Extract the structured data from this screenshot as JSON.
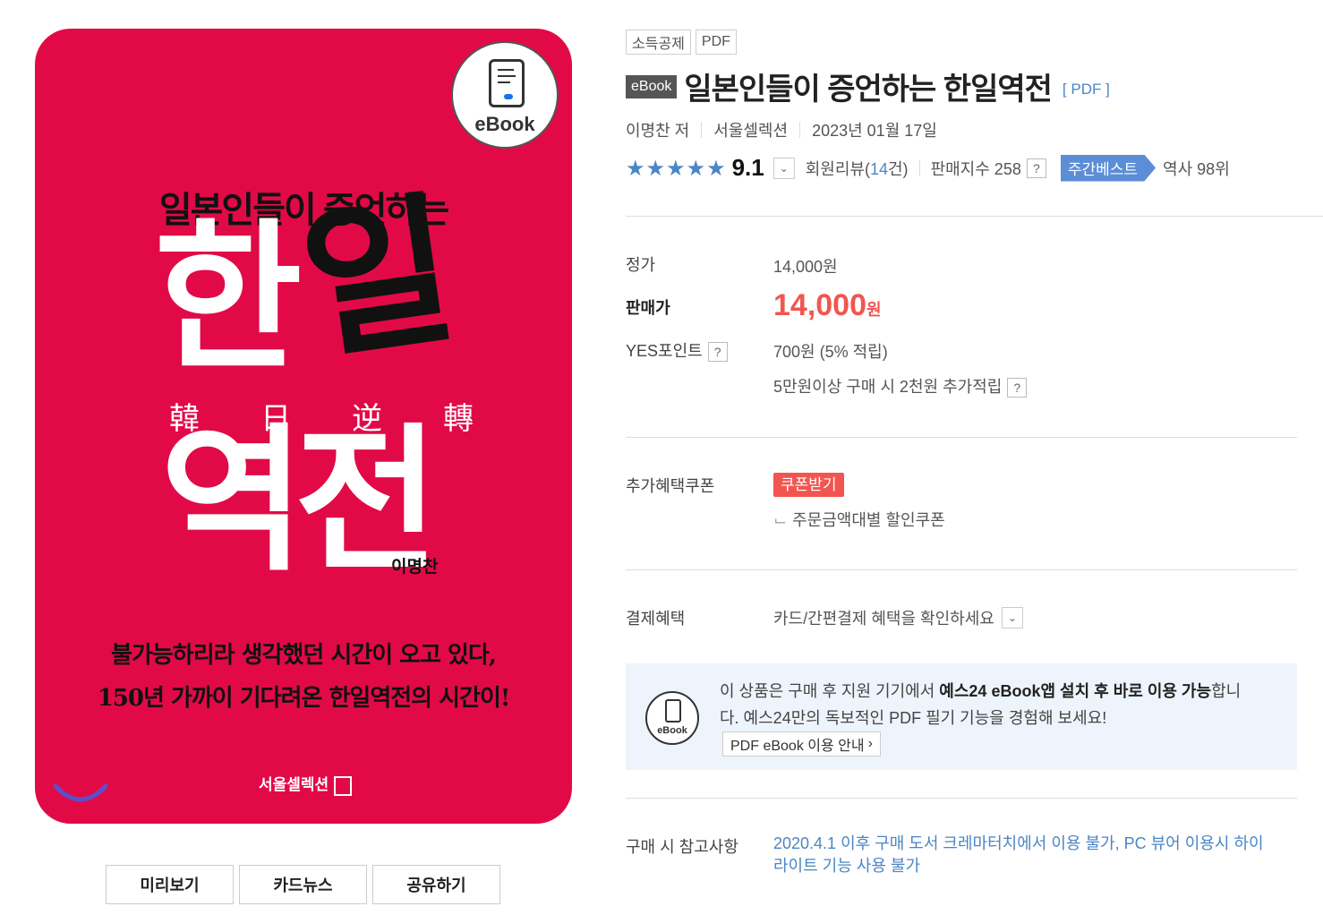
{
  "cover": {
    "badge_label": "eBook",
    "subtitle": "일본인들이 증언하는",
    "title_han": "한",
    "title_il": "일",
    "hanja": [
      "韓",
      "日",
      "逆",
      "轉"
    ],
    "title_yeokjeon": "역전",
    "author": "이명찬",
    "copy_line1": "불가능하리라 생각했던 시간이 오고 있다,",
    "copy_line2": "150년 가까이 기다려온 한일역전의 시간이!",
    "publisher": "서울셀렉션"
  },
  "cover_actions": {
    "preview": "미리보기",
    "cardnews": "카드뉴스",
    "share": "공유하기"
  },
  "tags": [
    "소득공제",
    "PDF"
  ],
  "product": {
    "type_badge": "eBook",
    "title": "일본인들이 증언하는 한일역전",
    "format": "[ PDF ]",
    "author": "이명찬 저",
    "publisher": "서울셀렉션",
    "date": "2023년 01월 17일"
  },
  "rating": {
    "stars": "★★★★★",
    "score": "9.1",
    "review_label": "회원리뷰(",
    "review_count": "14",
    "review_suffix": "건)",
    "sales_label": "판매지수 258",
    "weekly_best": "주간베스트",
    "rank": "역사 98위"
  },
  "price": {
    "list_label": "정가",
    "list_value": "14,000원",
    "sale_label": "판매가",
    "sale_value": "14,000",
    "sale_unit": "원",
    "points_label": "YES포인트",
    "points_value": "700원 (5% 적립)",
    "points_extra": "5만원이상 구매 시 2천원 추가적립"
  },
  "coupon": {
    "label": "추가혜택쿠폰",
    "button": "쿠폰받기",
    "sub": "주문금액대별 할인쿠폰"
  },
  "payment": {
    "label": "결제혜택",
    "value": "카드/간편결제 혜택을 확인하세요"
  },
  "notice": {
    "icon_label": "eBook",
    "text_pre": "이 상품은 구매 후 지원 기기에서 ",
    "text_bold": "예스24 eBook앱 설치 후 바로 이용 가능",
    "text_post": "합니다. 예스24만의 독보적인 PDF 필기 기능을 경험해 보세요!",
    "guide_button": "PDF eBook 이용 안내"
  },
  "purchase_note": {
    "label": "구매 시 참고사항",
    "text": "2020.4.1 이후 구매 도서 크레마터치에서 이용 불가, PC 뷰어 이용시 하이라이트 기능 사용 불가"
  },
  "colors": {
    "cover_red": "#e10a47",
    "accent_blue": "#4a86c5",
    "price_red": "#f2554f",
    "weekly_blue": "#5b8ed6"
  }
}
